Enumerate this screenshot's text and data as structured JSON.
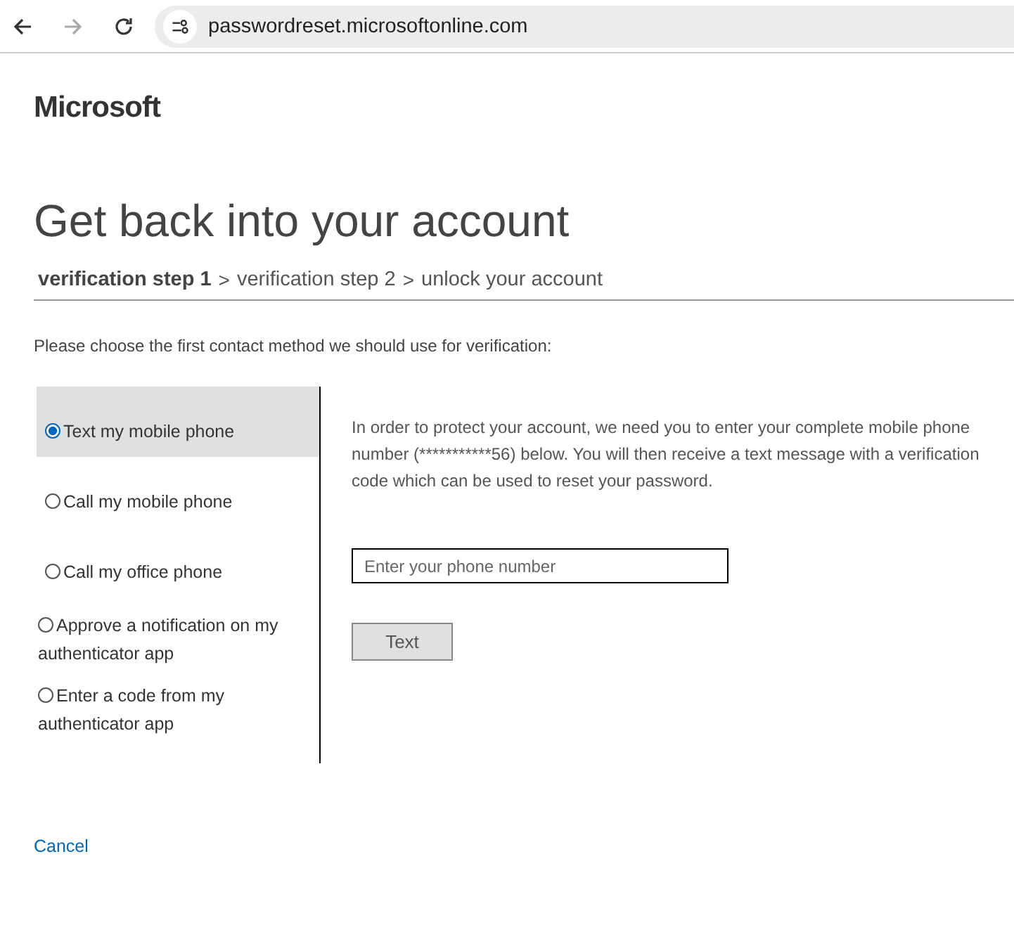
{
  "browser": {
    "url": "passwordreset.microsoftonline.com",
    "forward_disabled": true
  },
  "brand": "Microsoft",
  "title": "Get back into your account",
  "steps": [
    {
      "label": "verification step 1",
      "selected": true
    },
    {
      "label": "verification step 2",
      "selected": false
    },
    {
      "label": "unlock your account",
      "selected": false
    }
  ],
  "step_separator": ">",
  "instruction": "Please choose the first contact method we should use for verification:",
  "methods": [
    {
      "label": "Text my mobile phone",
      "selected": true
    },
    {
      "label": "Call my mobile phone",
      "selected": false
    },
    {
      "label": "Call my office phone",
      "selected": false
    },
    {
      "label": "Approve a notification on my authenticator app",
      "selected": false
    },
    {
      "label": "Enter a code from my authenticator app",
      "selected": false
    }
  ],
  "detail": {
    "description": "In order to protect your account, we need you to enter your complete mobile phone number (***********56) below. You will then receive a text message with a verification code which can be used to reset your password.",
    "phone_field": {
      "placeholder": "Enter your phone number"
    },
    "button": "Text"
  },
  "cancel": "Cancel"
}
